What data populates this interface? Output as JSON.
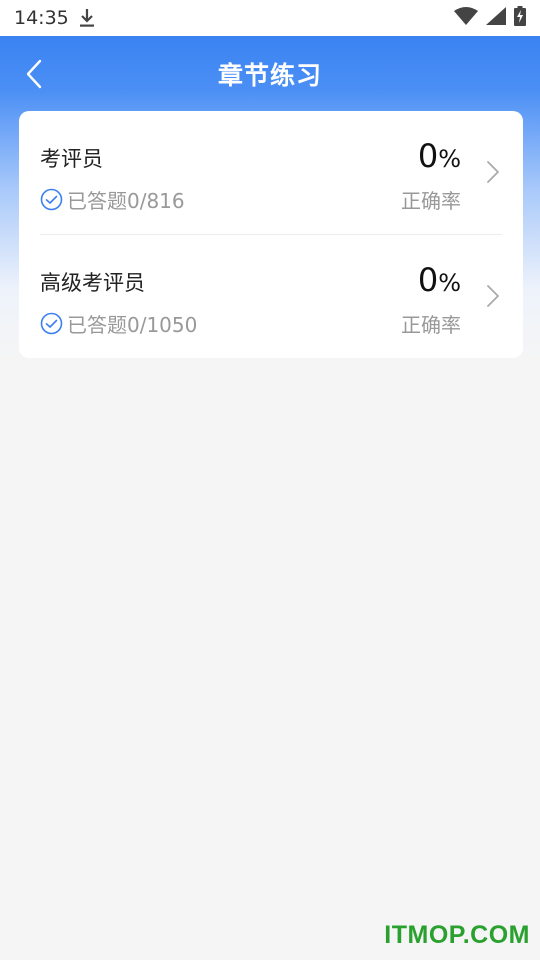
{
  "status_bar": {
    "time": "14:35"
  },
  "header": {
    "title": "章节练习"
  },
  "chapters": [
    {
      "name": "考评员",
      "progress_text": "已答题0/816",
      "rate_value": "0",
      "rate_unit": "%",
      "rate_label": "正确率"
    },
    {
      "name": "高级考评员",
      "progress_text": "已答题0/1050",
      "rate_value": "0",
      "rate_unit": "%",
      "rate_label": "正确率"
    }
  ],
  "watermark": "ITMOP.COM",
  "colors": {
    "header_blue": "#2f7bf0",
    "check_blue": "#3b7ff0",
    "watermark_green": "#2aa12e"
  }
}
